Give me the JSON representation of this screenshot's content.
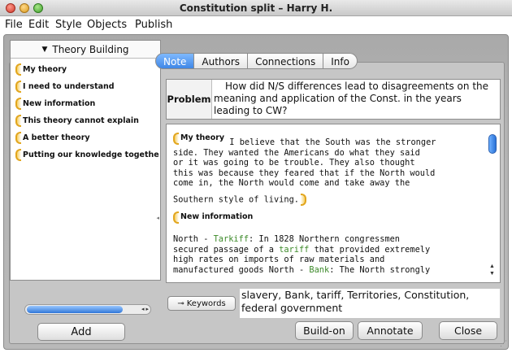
{
  "window": {
    "title": "Constitution split – Harry H."
  },
  "menu": {
    "items": [
      "File",
      "Edit",
      "Style",
      "Objects",
      "Publish"
    ]
  },
  "tabs": [
    {
      "label": "Note",
      "active": true
    },
    {
      "label": "Authors",
      "active": false
    },
    {
      "label": "Connections",
      "active": false
    },
    {
      "label": "Info",
      "active": false
    }
  ],
  "left_panel": {
    "header": "Theory Building",
    "items": [
      {
        "label": "My theory"
      },
      {
        "label": "I need to understand"
      },
      {
        "label": "New information"
      },
      {
        "label": "This theory cannot explain"
      },
      {
        "label": "A better theory"
      },
      {
        "label": "Putting our knowledge togethe"
      }
    ],
    "add_label": "Add"
  },
  "problem": {
    "label": "Problem",
    "text_line1": "How did N/S differences lead to disagreements on the",
    "text_line2": "meaning and application of the Const. in the years",
    "text_line3": "leading to CW?"
  },
  "note": {
    "scaffold1": "My theory",
    "para1_line1": " I believe that the South was the stronger",
    "para1_line2": "side.  They wanted the Americans do what they said",
    "para1_line3": "or it was going to be trouble.  They also thought",
    "para1_line4": "this was because they feared that if the North would",
    "para1_line5": "come in, the North would come and take away the",
    "para1_line6": "Southern style of living.",
    "scaffold2": "New information",
    "para2_prefix": "North - ",
    "para2_kw1a": "Tar",
    "para2_kw1b": "kiff",
    "para2_line1_rest": ": In  1828 Northern congressmen",
    "para2_line2_pre": "secured passage of a ",
    "para2_kw2": "tariff",
    "para2_line2_rest": " that provided extremely",
    "para2_line3": "high rates on imports of raw materials and",
    "para2_line4_pre": "manufactured goods North - ",
    "para2_kw3": "Bank",
    "para2_line4_rest": ": The North strongly"
  },
  "keywords": {
    "button_label": "Keywords",
    "text_line1": "slavery, Bank, tariff, Territories, Constitution,",
    "text_line2": "federal government"
  },
  "buttons": {
    "build_on": "Build-on",
    "annotate": "Annotate",
    "close": "Close"
  },
  "colors": {
    "scaffold": "#e2a61e",
    "accent": "#3f87e6",
    "keyword": "#3d8a2a"
  }
}
